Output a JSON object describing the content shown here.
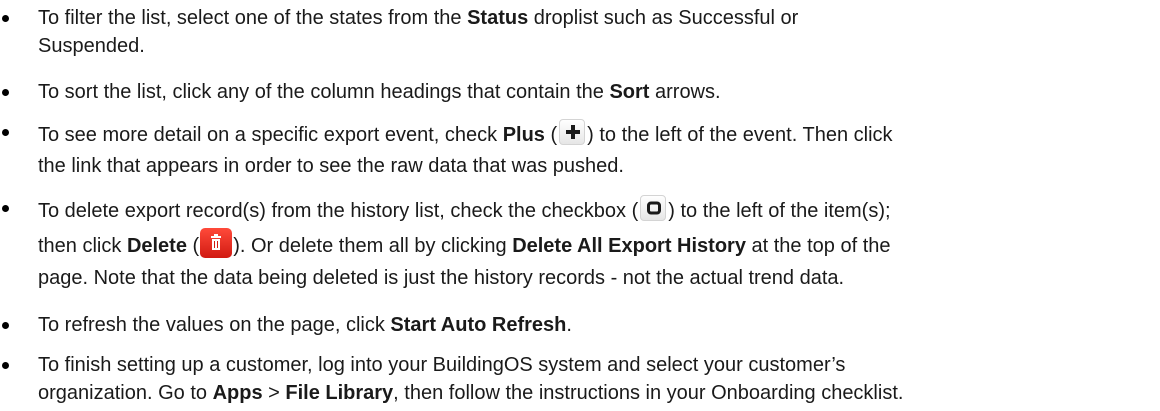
{
  "items": [
    {
      "pre": "To filter the list, select one of the states from the ",
      "bold": "Status",
      "post": " droplist such as Successful or",
      "line2": "Suspended."
    },
    {
      "pre": "To sort the list, click any of the column headings that contain the ",
      "bold": "Sort",
      "post": " arrows."
    },
    {
      "pre": "To see more detail on a specific export event, check ",
      "bold": "Plus",
      "open": " (",
      "close": ") to the left of the event. Then click",
      "line2": "the link that appears in order to see the raw data that was pushed.",
      "icon": "plus-icon"
    },
    {
      "pre": "To delete export record(s) from the history list, check the checkbox (",
      "close": ") to the left of the item(s);",
      "icon": "checkbox-icon",
      "l2_pre": "then click ",
      "l2_bold1": "Delete",
      "l2_open": " (",
      "l2_mid": "). Or delete them all by clicking ",
      "l2_bold2": "Delete All Export History",
      "l2_post": " at the top of the",
      "line3": "page. Note that the data being deleted is just the history records - not the actual trend data.",
      "icon2": "trash-icon"
    },
    {
      "pre": "To refresh the values on the page, click ",
      "bold": "Start Auto Refresh",
      "post": "."
    },
    {
      "pre": "To finish setting up a customer, log into your BuildingOS system and select your customer’s",
      "l2_pre": "organization. Go to ",
      "l2_bold1": "Apps",
      "l2_mid": " > ",
      "l2_bold2": "File Library",
      "l2_post": ", then follow the instructions in your Onboarding checklist."
    }
  ],
  "colors": {
    "text": "#1a1a1a",
    "delete_button": "#e0261c"
  }
}
